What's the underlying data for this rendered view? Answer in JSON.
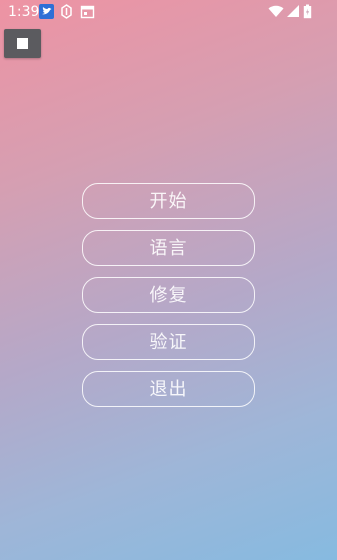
{
  "status_bar": {
    "time": "1:39",
    "icons": [
      "twitter-bird-notification-icon",
      "app-notification-icon",
      "calendar-notification-icon",
      "wifi-icon",
      "signal-icon",
      "battery-icon"
    ]
  },
  "stop_button": {
    "icon": "stop-icon"
  },
  "menu": {
    "items": [
      {
        "label": "开始"
      },
      {
        "label": "语言"
      },
      {
        "label": "修复"
      },
      {
        "label": "验证"
      },
      {
        "label": "退出"
      }
    ]
  },
  "colors": {
    "gradient_top": "#ee93a3",
    "gradient_bottom": "#86bae0",
    "button_border": "#ffffff",
    "stop_button_bg": "#5b5b5f"
  }
}
